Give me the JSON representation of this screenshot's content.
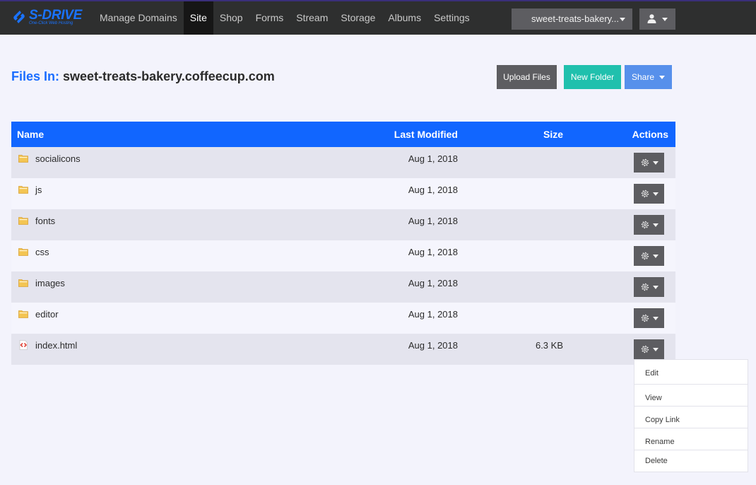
{
  "brand": {
    "name": "S-DRIVE",
    "tagline": "One-Click Web Hosting",
    "color": "#1a73ff"
  },
  "nav": {
    "items": [
      {
        "label": "Manage Domains",
        "active": false
      },
      {
        "label": "Site",
        "active": true
      },
      {
        "label": "Shop",
        "active": false
      },
      {
        "label": "Forms",
        "active": false
      },
      {
        "label": "Stream",
        "active": false
      },
      {
        "label": "Storage",
        "active": false
      },
      {
        "label": "Albums",
        "active": false
      },
      {
        "label": "Settings",
        "active": false
      }
    ],
    "domain_select": "sweet-treats-bakery...",
    "user_icon": "user-icon"
  },
  "header": {
    "label": "Files In:",
    "domain": "sweet-treats-bakery.coffeecup.com",
    "upload_label": "Upload Files",
    "new_folder_label": "New Folder",
    "share_label": "Share"
  },
  "table": {
    "columns": {
      "name": "Name",
      "modified": "Last Modified",
      "size": "Size",
      "actions": "Actions"
    },
    "rows": [
      {
        "name": "socialicons",
        "type": "folder",
        "modified": "Aug 1, 2018",
        "size": ""
      },
      {
        "name": "js",
        "type": "folder",
        "modified": "Aug 1, 2018",
        "size": ""
      },
      {
        "name": "fonts",
        "type": "folder",
        "modified": "Aug 1, 2018",
        "size": ""
      },
      {
        "name": "css",
        "type": "folder",
        "modified": "Aug 1, 2018",
        "size": ""
      },
      {
        "name": "images",
        "type": "folder",
        "modified": "Aug 1, 2018",
        "size": ""
      },
      {
        "name": "editor",
        "type": "folder",
        "modified": "Aug 1, 2018",
        "size": ""
      },
      {
        "name": "index.html",
        "type": "html-file",
        "modified": "Aug 1, 2018",
        "size": "6.3 KB"
      }
    ]
  },
  "actions_menu": {
    "items": [
      "Edit",
      "View",
      "Copy Link",
      "Rename",
      "Delete"
    ]
  },
  "colors": {
    "navbar_bg": "#2e2f2f",
    "table_header": "#1166ff",
    "upload_button": "#5d5d61",
    "new_folder_button": "#20c0ad",
    "share_button": "#5790eb",
    "title_label": "#1a6dff"
  }
}
